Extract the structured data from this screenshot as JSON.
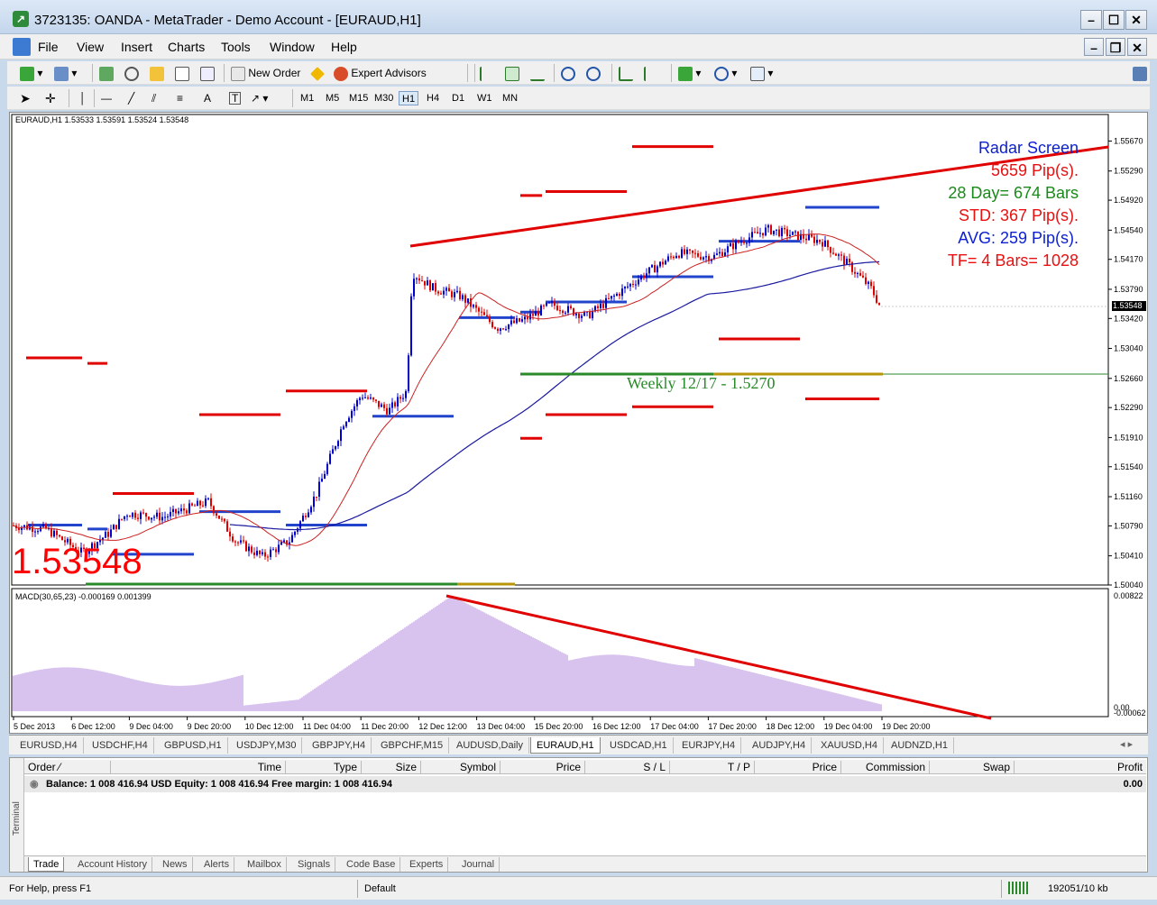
{
  "window": {
    "title": "3723135: OANDA - MetaTrader - Demo Account - [EURAUD,H1]"
  },
  "menu": [
    "File",
    "View",
    "Insert",
    "Charts",
    "Tools",
    "Window",
    "Help"
  ],
  "toolbar": {
    "new_order": "New Order",
    "expert_advisors": "Expert Advisors"
  },
  "draw_tools": {
    "text_tool": "A",
    "label_tool": "T"
  },
  "timeframes": [
    "M1",
    "M5",
    "M15",
    "M30",
    "H1",
    "H4",
    "D1",
    "W1",
    "MN"
  ],
  "active_timeframe": "H1",
  "chart": {
    "header": "EURAUD,H1  1.53533 1.53591 1.53524 1.53548",
    "big_price": "1.53548",
    "current_price_tag": "1.53548",
    "price_axis": [
      "1.55670",
      "1.55290",
      "1.54920",
      "1.54540",
      "1.54170",
      "1.53790",
      "1.53420",
      "1.53040",
      "1.52660",
      "1.52290",
      "1.51910",
      "1.51540",
      "1.51160",
      "1.50790",
      "1.50410",
      "1.50040"
    ],
    "time_axis": [
      "5 Dec 2013",
      "6 Dec 12:00",
      "9 Dec 04:00",
      "9 Dec 20:00",
      "10 Dec 12:00",
      "11 Dec 04:00",
      "11 Dec 20:00",
      "12 Dec 12:00",
      "13 Dec 04:00",
      "15 Dec 20:00",
      "16 Dec 12:00",
      "17 Dec 04:00",
      "17 Dec 20:00",
      "18 Dec 12:00",
      "19 Dec 04:00",
      "19 Dec 20:00"
    ],
    "radar": {
      "title": "Radar Screen",
      "line1": "5659 Pip(s).",
      "line2": "28 Day= 674 Bars",
      "line3": "STD: 367 Pip(s).",
      "line4": "AVG: 259 Pip(s).",
      "line5": "TF= 4 Bars= 1028"
    },
    "weekly_label": "Weekly 12/17 - 1.5270",
    "macd_header": "MACD(30,65,23) -0.000169 0.001399",
    "macd_axis_top": "0.00822",
    "macd_axis_mid": "0.00",
    "macd_axis_bottom": "-0.00062",
    "colors": {
      "bull": "#0000cc",
      "bear": "#dd0000",
      "ma_fast": "#cc2222",
      "ma_slow": "#1a1aa0",
      "macd": "#8844cc",
      "weekly": "#2a8a2a"
    }
  },
  "symbol_tabs": [
    "EURUSD,H4",
    "USDCHF,H4",
    "GBPUSD,H1",
    "USDJPY,M30",
    "GBPJPY,H4",
    "GBPCHF,M15",
    "AUDUSD,Daily",
    "EURAUD,H1",
    "USDCAD,H1",
    "EURJPY,H4",
    "AUDJPY,H4",
    "XAUUSD,H4",
    "AUDNZD,H1"
  ],
  "active_symbol_tab": "EURAUD,H1",
  "terminal": {
    "side_label": "Terminal",
    "columns": [
      "Order",
      "Time",
      "Type",
      "Size",
      "Symbol",
      "Price",
      "S / L",
      "T / P",
      "Price",
      "Commission",
      "Swap",
      "Profit"
    ],
    "balance_text": "Balance: 1 008 416.94 USD  Equity: 1 008 416.94  Free margin: 1 008 416.94",
    "profit": "0.00",
    "tabs": [
      "Trade",
      "Account History",
      "News",
      "Alerts",
      "Mailbox",
      "Signals",
      "Code Base",
      "Experts",
      "Journal"
    ],
    "active_tab": "Trade"
  },
  "status": {
    "help": "For Help, press F1",
    "profile": "Default",
    "traffic": "192051/10 kb"
  }
}
